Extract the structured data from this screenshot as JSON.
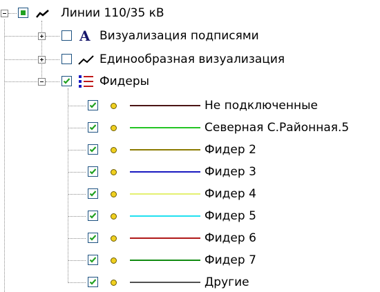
{
  "tree": {
    "root": {
      "label": "Линии 110/35 кВ",
      "icon": "line-layer-icon",
      "checked": "partial",
      "expanded": true
    },
    "children": [
      {
        "label": "Визуализация подписями",
        "icon": "text-label-icon",
        "checked": false,
        "expanded": false
      },
      {
        "label": "Единообразная визуализация",
        "icon": "line-layer-icon",
        "checked": false,
        "expanded": false
      },
      {
        "label": "Фидеры",
        "icon": "legend-list-icon",
        "checked": true,
        "expanded": true
      }
    ],
    "feeders": [
      {
        "label": "Не подключенные",
        "color": "#4a1414",
        "checked": true
      },
      {
        "label": "Северная С.Районная.5",
        "color": "#22c422",
        "checked": true
      },
      {
        "label": "Фидер 2",
        "color": "#8a7a00",
        "checked": true
      },
      {
        "label": "Фидер 3",
        "color": "#1818c0",
        "checked": true
      },
      {
        "label": "Фидер 4",
        "color": "#e4f070",
        "checked": true
      },
      {
        "label": "Фидер 5",
        "color": "#20e0f0",
        "checked": true
      },
      {
        "label": "Фидер 6",
        "color": "#b01818",
        "checked": true
      },
      {
        "label": "Фидер 7",
        "color": "#108a10",
        "checked": true
      },
      {
        "label": "Другие",
        "color": "#505050",
        "checked": true
      }
    ]
  }
}
